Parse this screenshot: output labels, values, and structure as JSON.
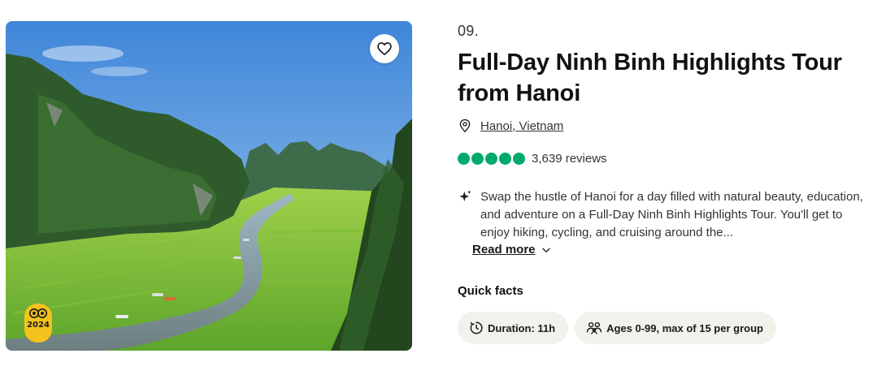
{
  "listing": {
    "rank": "09.",
    "title": "Full-Day Ninh Binh Highlights Tour from Hanoi",
    "location": "Hanoi, Vietnam",
    "rating_bubbles": 5,
    "review_count": "3,639 reviews",
    "summary": "Swap the hustle of Hanoi for a day filled with natural beauty, education, and adventure on a Full-Day Ninh Binh Highlights Tour. You'll get to enjoy hiking, cycling, and cruising around the...",
    "read_more": "Read more"
  },
  "quick_facts": {
    "title": "Quick facts",
    "duration": "Duration: 11h",
    "group": "Ages 0-99, max of 15 per group"
  },
  "badge": {
    "year": "2024"
  },
  "colors": {
    "rating_green": "#00aa6c",
    "chip_bg": "#f2f1ec",
    "badge_yellow": "#f4c21e"
  },
  "icons": {
    "favorite": "heart-icon",
    "location": "map-pin-icon",
    "summary": "sparkle-icon",
    "read_more": "chevron-down-icon",
    "duration": "clock-icon",
    "group": "people-icon",
    "badge": "owl-icon"
  }
}
